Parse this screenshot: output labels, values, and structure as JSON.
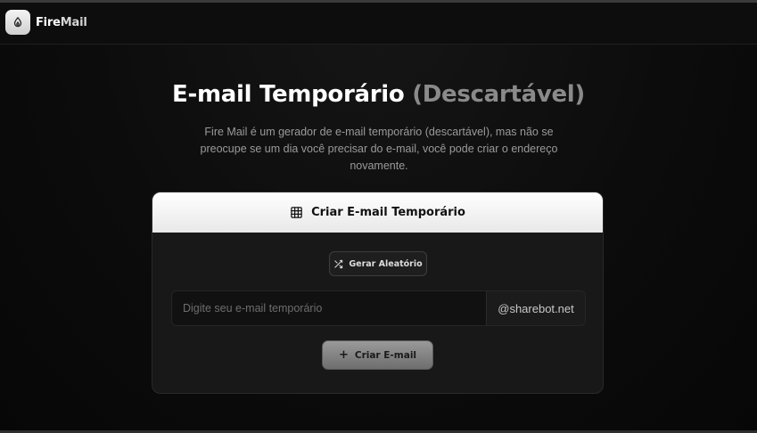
{
  "header": {
    "brand_primary": "Fire",
    "brand_secondary": "Mail",
    "logo_icon": "flame-drop-icon"
  },
  "hero": {
    "title_main": "E-mail Temporário",
    "title_accent": "(Descartável)",
    "description": "Fire Mail é um gerador de e-mail temporário (descartável), mas não se preocupe se um dia você precisar do e-mail, você pode criar o endereço novamente."
  },
  "card": {
    "title": "Criar E-mail Temporário",
    "title_icon": "table-grid-icon",
    "random_button_label": "Gerar Aleatório",
    "random_button_icon": "shuffle-icon",
    "email_input": {
      "value": "",
      "placeholder": "Digite seu e-mail temporário"
    },
    "domain_suffix": "@sharebot.net",
    "create_button_label": "Criar E-mail",
    "create_button_icon": "plus-icon"
  },
  "colors": {
    "background": "#0b0b0b",
    "card": "#181818",
    "card_header": "#ffffff",
    "accent_gray": "#8a8a8a",
    "create_button": "#8a8a8a"
  }
}
